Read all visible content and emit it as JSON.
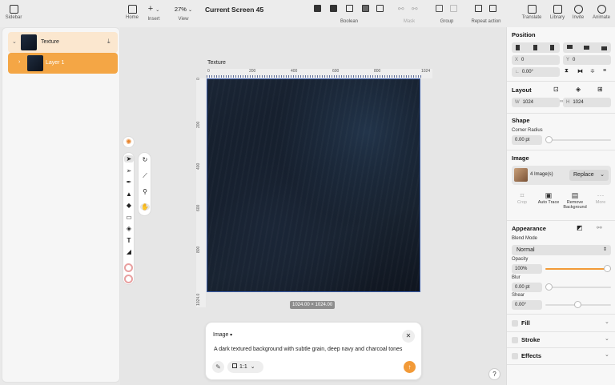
{
  "topbar": {
    "sidebar_label": "Sidebar",
    "home_label": "Home",
    "insert_label": "Insert",
    "zoom_value": "27%",
    "view_label": "View",
    "screen_title": "Current Screen 45",
    "boolean_label": "Boolean",
    "mask_label": "Mask",
    "group_label": "Group",
    "repeat_label": "Repeat action",
    "translate_label": "Translate",
    "library_label": "Library",
    "invite_label": "Invite",
    "animate_label": "Animate"
  },
  "layers": [
    {
      "name": "Texture"
    },
    {
      "name": "Layer 1"
    }
  ],
  "canvas": {
    "frame_label": "Texture",
    "h_ruler": [
      "0",
      "200",
      "400",
      "600",
      "800",
      "1024"
    ],
    "v_ruler": [
      "0",
      "200",
      "400",
      "600",
      "800",
      "1024.0"
    ],
    "size_badge": "1024.00 × 1024.00"
  },
  "prompt": {
    "mode": "Image",
    "text": "A dark textured background with subtle grain, deep navy and charcoal tones",
    "ratio": "1:1"
  },
  "inspector": {
    "position_title": "Position",
    "x_label": "X",
    "x_value": "0",
    "y_label": "Y",
    "y_value": "0",
    "rotation": "0.00°",
    "layout_title": "Layout",
    "w_label": "W",
    "w_value": "1024",
    "h_label": "H",
    "h_value": "1024",
    "shape_title": "Shape",
    "corner_label": "Corner Radius",
    "corner_value": "0.00 pt",
    "image_title": "Image",
    "image_count": "4 Image(s)",
    "replace_label": "Replace",
    "crop_label": "Crop",
    "autotrace_label": "Auto Trace",
    "remove_bg_line1": "Remove",
    "remove_bg_line2": "Background",
    "more_label": "More",
    "appearance_title": "Appearance",
    "blend_label": "Blend Mode",
    "blend_value": "Normal",
    "opacity_label": "Opacity",
    "opacity_value": "100%",
    "opacity_level": 1.0,
    "blur_label": "Blur",
    "blur_value": "0.00 pt",
    "shear_label": "Shear",
    "shear_value": "0.00°",
    "fill_label": "Fill",
    "stroke_label": "Stroke",
    "effects_label": "Effects"
  },
  "help_label": "?",
  "colors": {
    "accent": "#f29a38",
    "selected_row": "#f4a645",
    "parent_row": "#fbe7cf",
    "texture_dark": "#121a26"
  }
}
